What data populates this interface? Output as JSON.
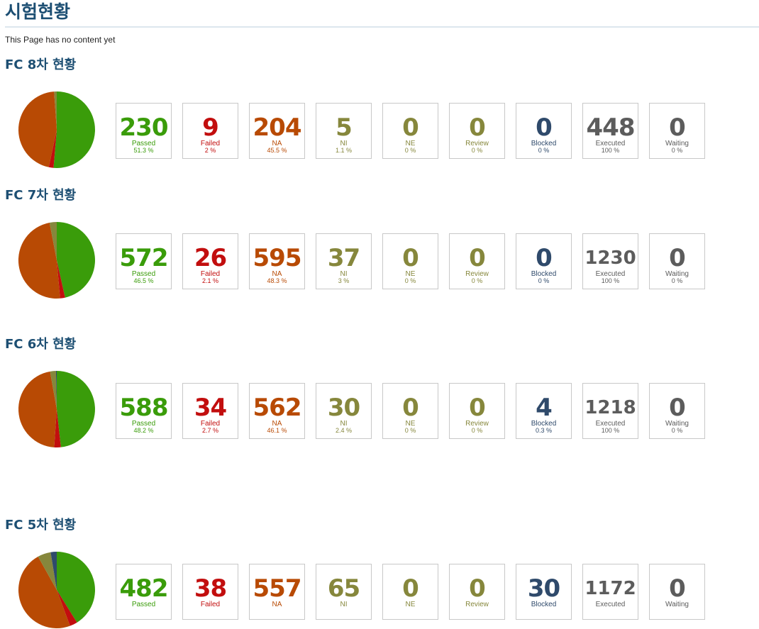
{
  "page_title": "시험현황",
  "note": "This Page has no content yet",
  "colors": {
    "Passed": "#3a9c0a",
    "Failed": "#c20e0e",
    "NA": "#b84a04",
    "NI": "#86873c",
    "NE": "#86873c",
    "Review": "#86873c",
    "Blocked": "#2f4a6b",
    "Executed": "#5c5c5c",
    "Waiting": "#5c5c5c"
  },
  "chart_data": [
    {
      "type": "pie",
      "title": "FC 8차 현황",
      "categories": [
        "Passed",
        "Failed",
        "NA",
        "NI",
        "NE",
        "Review",
        "Blocked",
        "Executed",
        "Waiting"
      ],
      "values": [
        "230",
        "9",
        "204",
        "5",
        "0",
        "0",
        "0",
        "448",
        "0"
      ],
      "percents": [
        "51.3 %",
        "2 %",
        "45.5 %",
        "1.1 %",
        "0 %",
        "0 %",
        "0 %",
        "100 %",
        "0 %"
      ]
    },
    {
      "type": "pie",
      "title": "FC 7차 현황",
      "categories": [
        "Passed",
        "Failed",
        "NA",
        "NI",
        "NE",
        "Review",
        "Blocked",
        "Executed",
        "Waiting"
      ],
      "values": [
        "572",
        "26",
        "595",
        "37",
        "0",
        "0",
        "0",
        "1230",
        "0"
      ],
      "percents": [
        "46.5 %",
        "2.1 %",
        "48.3 %",
        "3 %",
        "0 %",
        "0 %",
        "0 %",
        "100 %",
        "0 %"
      ]
    },
    {
      "type": "pie",
      "title": "FC 6차 현황",
      "categories": [
        "Passed",
        "Failed",
        "NA",
        "NI",
        "NE",
        "Review",
        "Blocked",
        "Executed",
        "Waiting"
      ],
      "values": [
        "588",
        "34",
        "562",
        "30",
        "0",
        "0",
        "4",
        "1218",
        "0"
      ],
      "percents": [
        "48.2 %",
        "2.7 %",
        "46.1 %",
        "2.4 %",
        "0 %",
        "0 %",
        "0.3 %",
        "100 %",
        "0 %"
      ]
    },
    {
      "type": "pie",
      "title": "FC 5차 현황",
      "categories": [
        "Passed",
        "Failed",
        "NA",
        "NI",
        "NE",
        "Review",
        "Blocked",
        "Executed",
        "Waiting"
      ],
      "values": [
        "482",
        "38",
        "557",
        "65",
        "0",
        "0",
        "30",
        "1172",
        "0"
      ],
      "percents": [
        "",
        "",
        "",
        "",
        "",
        "",
        "",
        "",
        ""
      ]
    }
  ]
}
